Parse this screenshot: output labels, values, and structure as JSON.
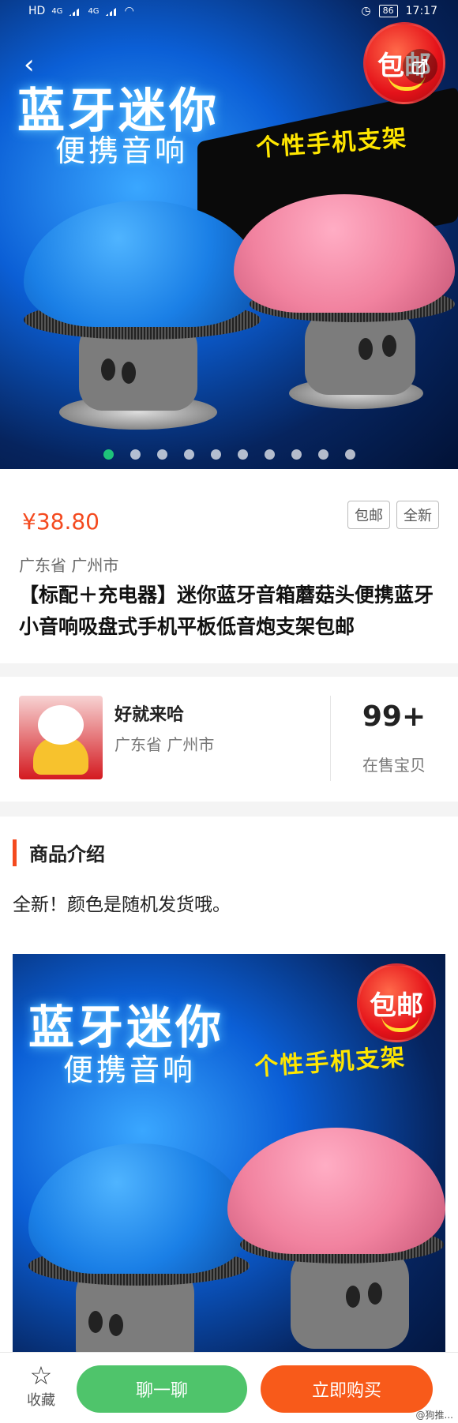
{
  "status_bar": {
    "network_label": "HD",
    "signal_label_1": "4G",
    "signal_label_2": "4G",
    "battery": "86",
    "time": "17:17"
  },
  "hero": {
    "title": "蓝牙迷你",
    "subtitle": "便携音响",
    "side_text": "个性手机支架",
    "badge": "包邮",
    "image_count": 10,
    "active_index": 0,
    "colors": {
      "active_dot": "#1ec37a"
    }
  },
  "product": {
    "price": "¥38.80",
    "tags": [
      "包邮",
      "全新"
    ],
    "location": "广东省 广州市",
    "title": "【标配＋充电器】迷你蓝牙音箱蘑菇头便携蓝牙小音响吸盘式手机平板低音炮支架包邮"
  },
  "seller": {
    "name": "好就来哈",
    "location": "广东省 广州市",
    "count": "99+",
    "count_label": "在售宝贝"
  },
  "intro": {
    "heading": "商品介绍",
    "description": "全新！颜色是随机发货哦。",
    "image_title": "蓝牙迷你",
    "image_subtitle": "便携音响",
    "image_side_text": "个性手机支架",
    "image_badge": "包邮"
  },
  "bottom_bar": {
    "favorite_label": "收藏",
    "chat_label": "聊一聊",
    "buy_label": "立即购买",
    "watermark": "@狗推..."
  },
  "icons": {
    "back": "back-arrow-icon",
    "share": "share-icon",
    "favorite": "star-outline-icon"
  },
  "colors": {
    "price": "#f44a1f",
    "chat_button": "#4fc46b",
    "buy_button": "#f85a1a",
    "section_accent": "#f44a1f"
  }
}
